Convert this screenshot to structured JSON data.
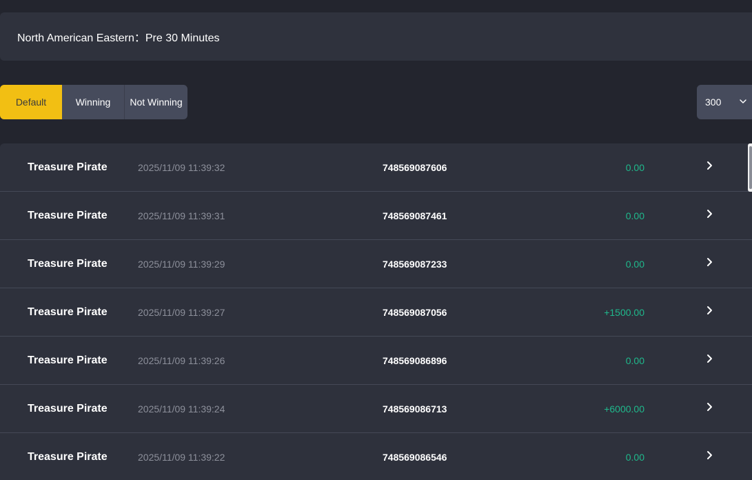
{
  "header": {
    "timezone_text": "North American Eastern：Pre 30 Minutes"
  },
  "filters": {
    "tabs": [
      {
        "label": "Default",
        "active": true
      },
      {
        "label": "Winning",
        "active": false
      },
      {
        "label": "Not Winning",
        "active": false
      }
    ]
  },
  "page_size": {
    "selected": "300",
    "icon": "chevron-down-icon"
  },
  "records": [
    {
      "game": "Treasure Pirate",
      "time": "2025/11/09 11:39:32",
      "order_id": "748569087606",
      "amount": "0.00"
    },
    {
      "game": "Treasure Pirate",
      "time": "2025/11/09 11:39:31",
      "order_id": "748569087461",
      "amount": "0.00"
    },
    {
      "game": "Treasure Pirate",
      "time": "2025/11/09 11:39:29",
      "order_id": "748569087233",
      "amount": "0.00"
    },
    {
      "game": "Treasure Pirate",
      "time": "2025/11/09 11:39:27",
      "order_id": "748569087056",
      "amount": "+1500.00"
    },
    {
      "game": "Treasure Pirate",
      "time": "2025/11/09 11:39:26",
      "order_id": "748569086896",
      "amount": "0.00"
    },
    {
      "game": "Treasure Pirate",
      "time": "2025/11/09 11:39:24",
      "order_id": "748569086713",
      "amount": "+6000.00"
    },
    {
      "game": "Treasure Pirate",
      "time": "2025/11/09 11:39:22",
      "order_id": "748569086546",
      "amount": "0.00"
    }
  ],
  "row_icon": "chevron-right-icon",
  "colors": {
    "accent": "#f2bf13",
    "amount": "#1fb98c",
    "background": "#23252e",
    "panel": "#2e313c"
  }
}
